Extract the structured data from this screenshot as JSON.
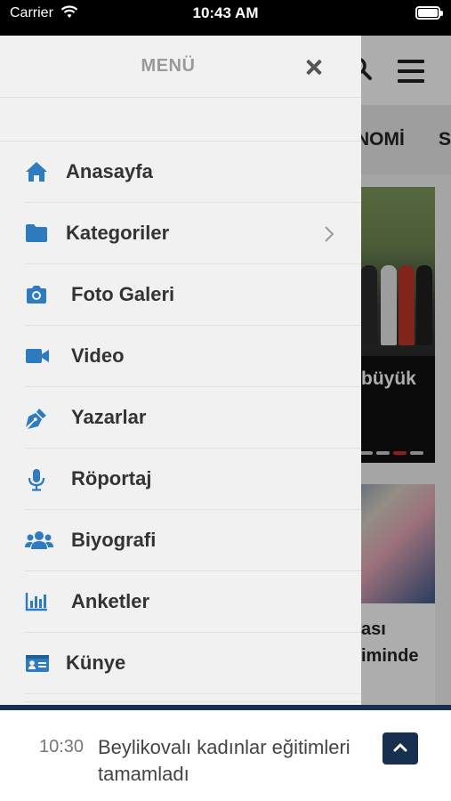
{
  "status_bar": {
    "carrier": "Carrier",
    "time": "10:43 AM"
  },
  "background": {
    "nav_items": [
      "NOMİ",
      "S"
    ],
    "slider_caption": "büyük",
    "card_title_line1": "ası",
    "card_title_line2": "iminde"
  },
  "drawer": {
    "title": "MENÜ",
    "items": [
      {
        "label": "Anasayfa",
        "icon": "home-icon"
      },
      {
        "label": "Kategoriler",
        "icon": "folder-icon",
        "has_submenu": true
      },
      {
        "label": "Foto Galeri",
        "icon": "camera-icon"
      },
      {
        "label": "Video",
        "icon": "video-camera-icon"
      },
      {
        "label": "Yazarlar",
        "icon": "pen-nib-icon"
      },
      {
        "label": "Röportaj",
        "icon": "microphone-icon"
      },
      {
        "label": "Biyografi",
        "icon": "users-icon"
      },
      {
        "label": "Anketler",
        "icon": "bar-chart-icon"
      },
      {
        "label": "Künye",
        "icon": "id-card-icon"
      }
    ]
  },
  "ticker": {
    "time": "10:30",
    "headline": "Beylikovalı kadınlar eğitimleri tamamladı"
  },
  "colors": {
    "accent": "#2e7bbf",
    "ticker_bar": "#17304f",
    "slider_active_dot": "#d62b2b"
  }
}
